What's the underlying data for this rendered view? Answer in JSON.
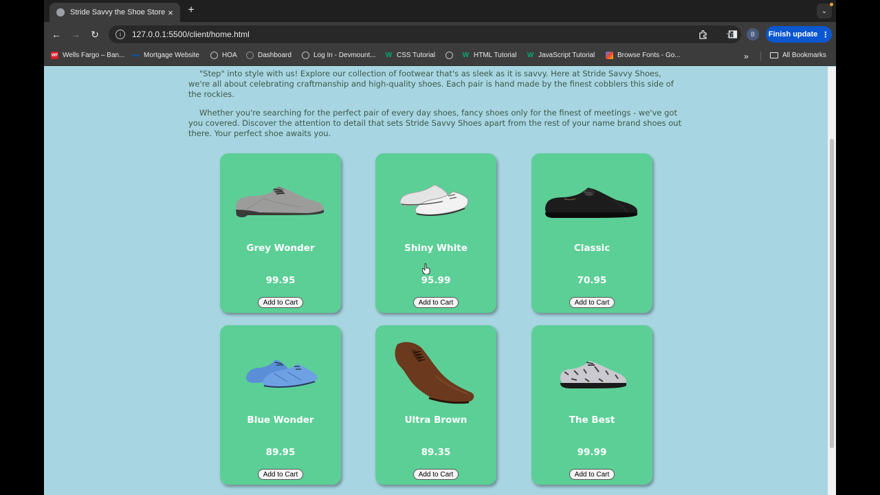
{
  "browser": {
    "tab_title": "Stride Savvy the Shoe Store",
    "tab_close": "×",
    "new_tab": "+",
    "url": "127.0.0.1:5500/client/home.html",
    "profile_initial": "B",
    "update_label": "Finish update",
    "update_menu": "⋮",
    "back": "←",
    "forward": "→",
    "reload": "↻",
    "star": "☆",
    "tab_menu": "⌄"
  },
  "bookmarks": [
    {
      "label": "Wells Fargo – Ban...",
      "icon": "WF",
      "color": "#d71e28"
    },
    {
      "label": "Mortgage Website",
      "icon": "",
      "color": "#1a4e8a"
    },
    {
      "label": "HOA",
      "icon": "globe-icon",
      "color": "#9aa0a6"
    },
    {
      "label": "Dashboard",
      "icon": "dashboard-icon",
      "color": "#5f6368"
    },
    {
      "label": "Log In - Devmount...",
      "icon": "globe-icon",
      "color": "#9aa0a6"
    },
    {
      "label": "CSS Tutorial",
      "icon": "w3-icon",
      "color": "#04aa6d"
    },
    {
      "label": "",
      "icon": "globe-icon",
      "color": "#9aa0a6"
    },
    {
      "label": "HTML Tutorial",
      "icon": "w3-icon",
      "color": "#04aa6d"
    },
    {
      "label": "JavaScript Tutorial",
      "icon": "w3-icon",
      "color": "#04aa6d"
    },
    {
      "label": "Browse Fonts - Go...",
      "icon": "google-fonts-icon",
      "color": "#e37400"
    }
  ],
  "bookmarks_more": "»",
  "all_bookmarks": "All Bookmarks",
  "intro": {
    "p1": "\"Step\" into style with us! Explore our collection of footwear that's as sleek as it is savvy. Here at Stride Savvy Shoes, we're all about celebrating craftmanship and high-quality shoes. Each pair is hand made by the finest cobblers this side of the rockies.",
    "p2": "Whether you're searching for the perfect pair of every day shoes, fancy shoes only for the finest of meetings - we've got you covered. Discover the attention to detail that sets Stride Savvy Shoes apart from the rest of your name brand shoes out there. Your perfect shoe awaits you."
  },
  "products": [
    {
      "name": "Grey Wonder",
      "price": "99.95",
      "button": "Add to Cart"
    },
    {
      "name": "Shiny White",
      "price": "95.99",
      "button": "Add to Cart"
    },
    {
      "name": "Classic",
      "price": "70.95",
      "button": "Add to Cart"
    },
    {
      "name": "Blue Wonder",
      "price": "89.95",
      "button": "Add to Cart"
    },
    {
      "name": "Ultra Brown",
      "price": "89.35",
      "button": "Add to Cart"
    },
    {
      "name": "The Best",
      "price": "99.99",
      "button": "Add to Cart"
    }
  ],
  "colors": {
    "page_bg": "#a8d5e2",
    "card_bg": "#5ccf96",
    "intro_text": "#3a5a48",
    "update_button": "#0b57d0"
  }
}
